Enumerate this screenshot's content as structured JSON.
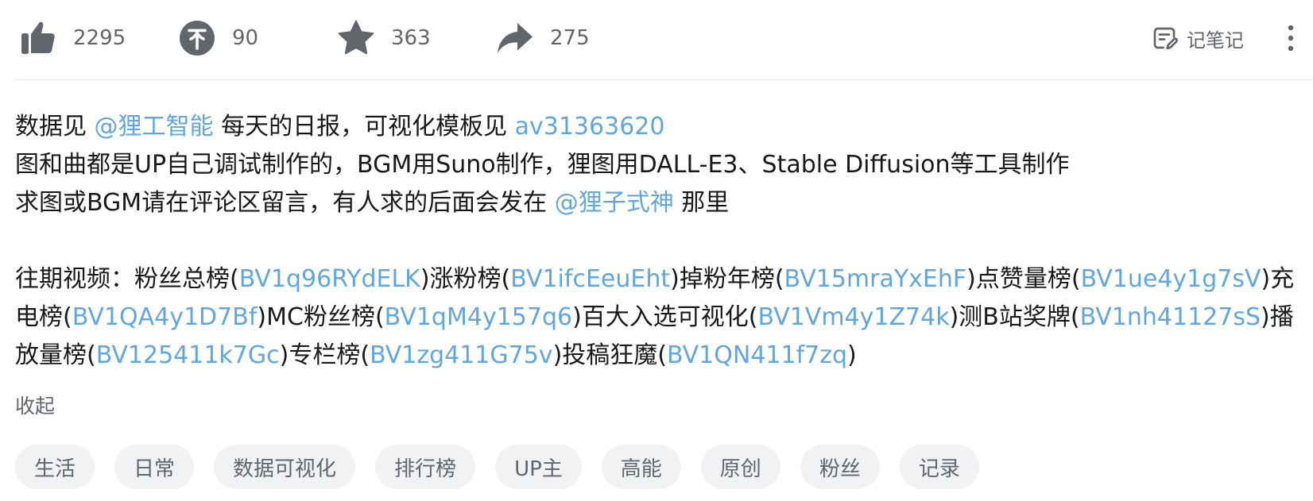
{
  "toolbar": {
    "like": {
      "icon": "thumbs-up-icon",
      "count": "2295"
    },
    "coin": {
      "icon": "coin-icon",
      "count": "90"
    },
    "favorite": {
      "icon": "star-icon",
      "count": "363"
    },
    "share": {
      "icon": "share-arrow-icon",
      "count": "275"
    },
    "note_label": "记笔记",
    "note_icon": "note-edit-icon",
    "more_icon": "more-vertical-icon"
  },
  "description": {
    "line1": {
      "t1": "数据见 ",
      "link1": "@狸工智能",
      "t2": " 每天的日报，可视化模板见 ",
      "link2": "av31363620"
    },
    "line2": "图和曲都是UP自己调试制作的，BGM用Suno制作，狸图用DALL-E3、Stable Diffusion等工具制作",
    "line3": {
      "t1": "求图或BGM请在评论区留言，有人求的后面会发在 ",
      "link1": "@狸子式神",
      "t2": " 那里"
    },
    "past_videos": {
      "prefix": "往期视频：",
      "items": [
        {
          "label": "粉丝总榜(",
          "link": "BV1q96RYdELK",
          "close": ")"
        },
        {
          "label": "涨粉榜(",
          "link": "BV1ifcEeuEht",
          "close": ")"
        },
        {
          "label": "掉粉年榜(",
          "link": "BV15mraYxEhF",
          "close": ")"
        },
        {
          "label": "点赞量榜(",
          "link": "BV1ue4y1g7sV",
          "close": ")"
        },
        {
          "label": "充电榜(",
          "link": "BV1QA4y1D7Bf",
          "close": ")"
        },
        {
          "label": "MC粉丝榜(",
          "link": "BV1qM4y157q6",
          "close": ")"
        },
        {
          "label": "百大入选可视化(",
          "link": "BV1Vm4y1Z74k",
          "close": ")"
        },
        {
          "label": "测B站奖牌(",
          "link": "BV1nh41127sS",
          "close": ")"
        },
        {
          "label": "播放量榜(",
          "link": "BV125411k7Gc",
          "close": ")"
        },
        {
          "label": "专栏榜(",
          "link": "BV1zg411G75v",
          "close": ")"
        },
        {
          "label": "投稿狂魔(",
          "link": "BV1QN411f7zq",
          "close": ")"
        }
      ]
    },
    "collapse_label": "收起"
  },
  "tags": [
    "生活",
    "日常",
    "数据可视化",
    "排行榜",
    "UP主",
    "高能",
    "原创",
    "粉丝",
    "记录"
  ],
  "colors": {
    "link": "#61a6dd",
    "icon": "#61666d",
    "text": "#18191c",
    "tag_bg": "#f1f2f3"
  }
}
